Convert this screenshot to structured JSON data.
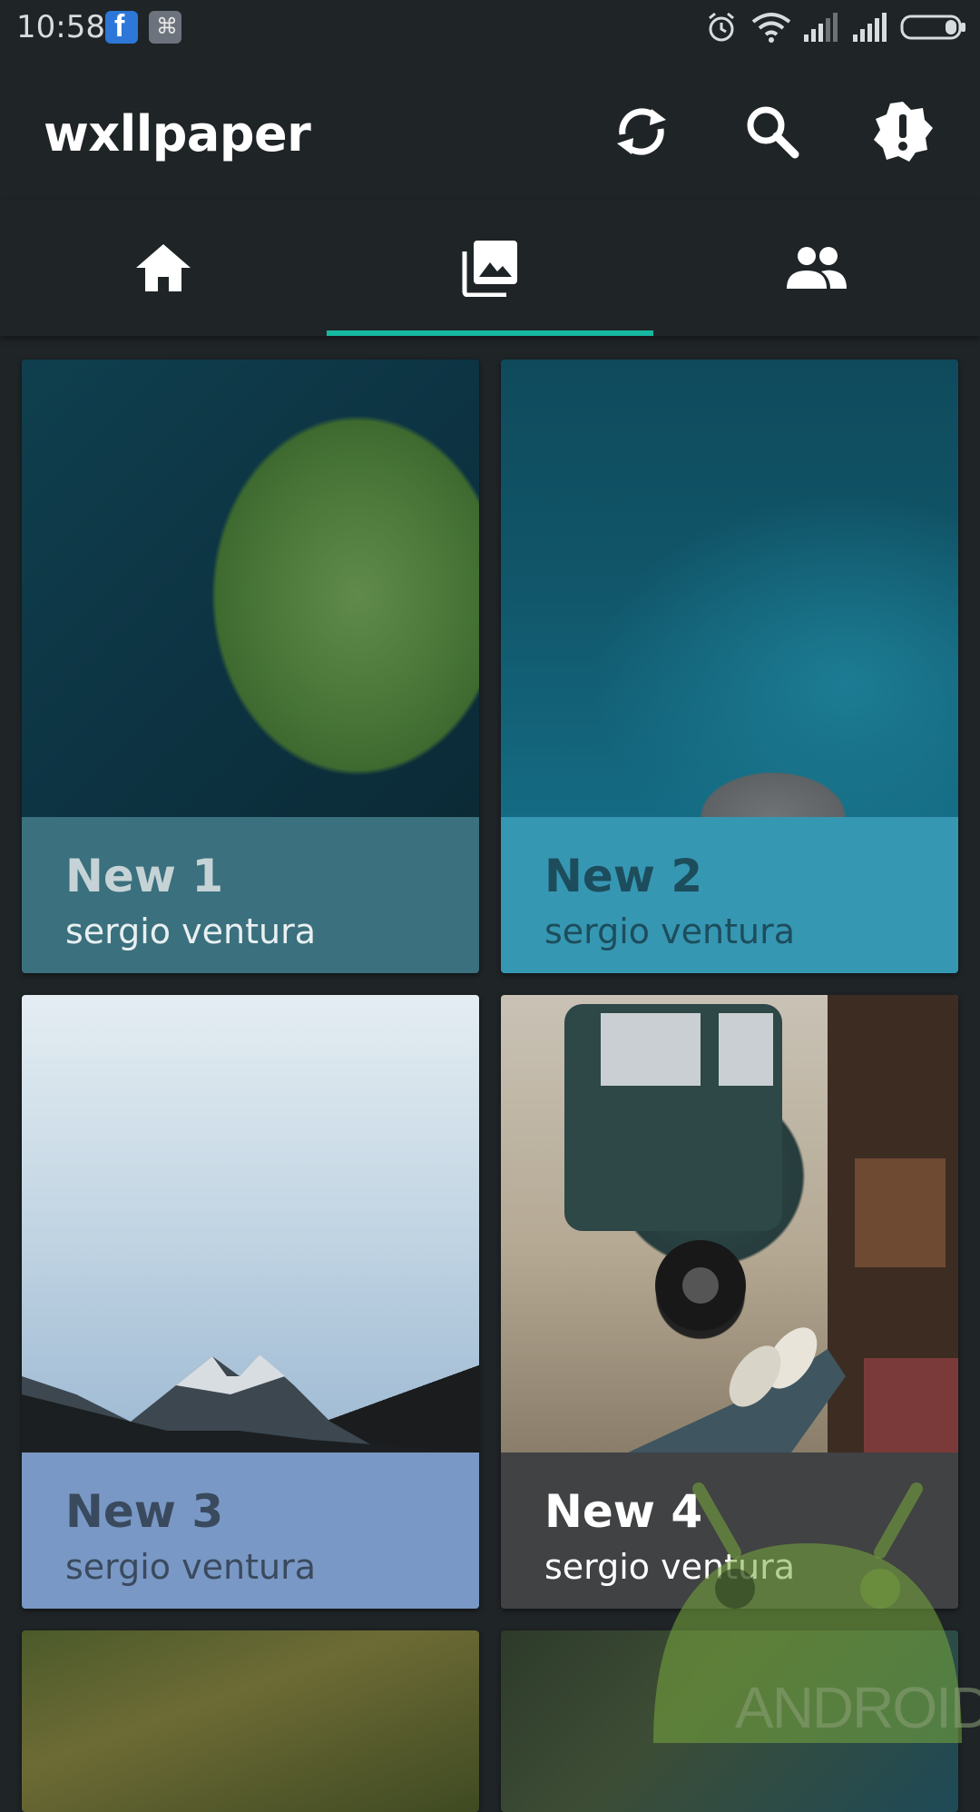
{
  "status_bar": {
    "time": "10:58",
    "notification_icons": [
      "facebook-icon",
      "app-notification-icon"
    ],
    "system_icons": [
      "alarm-icon",
      "wifi-icon",
      "signal-icon",
      "signal-icon",
      "battery-icon"
    ]
  },
  "app_bar": {
    "title": "wxllpaper",
    "actions": [
      "sync-icon",
      "search-icon",
      "alert-icon"
    ]
  },
  "tabs": [
    {
      "icon": "home-icon",
      "selected": false
    },
    {
      "icon": "gallery-icon",
      "selected": true
    },
    {
      "icon": "people-icon",
      "selected": false
    }
  ],
  "colors": {
    "background": "#1f2427",
    "tab_indicator": "#17b8a0",
    "card1_caption": "#3b707e",
    "card2_caption": "#3697b3",
    "card3_caption": "#7a98c5",
    "card4_caption": "#404244"
  },
  "cards": [
    {
      "title": "New 1",
      "author": "sergio ventura"
    },
    {
      "title": "New 2",
      "author": "sergio ventura"
    },
    {
      "title": "New 3",
      "author": "sergio ventura"
    },
    {
      "title": "New 4",
      "author": "sergio ventura"
    }
  ],
  "watermark": "ANDROID"
}
